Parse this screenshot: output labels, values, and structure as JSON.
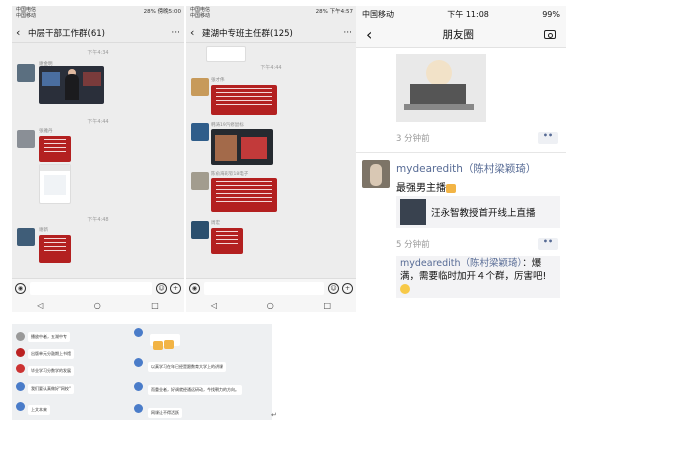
{
  "panel1": {
    "status": {
      "carrier1": "中国电信",
      "carrier2": "中国移动",
      "right": "28% 傍晚5:00"
    },
    "title": "中层干部工作群(61)",
    "more": "···",
    "times": [
      "下午4:34",
      "下午4:44",
      "下午4:48"
    ],
    "names": [
      "谢金明",
      "张雅丹",
      "谢新"
    ]
  },
  "panel2": {
    "status": {
      "carrier1": "中国电信",
      "carrier2": "中国移动",
      "right": "28% 下午4:57"
    },
    "title": "建湖中专班主任群(125)",
    "more": "···",
    "times": [
      "下午4:44"
    ],
    "names": [
      "张才伟",
      "韩涛19汽修鼠标",
      "陈俞海彩钦18电子",
      "周宏"
    ]
  },
  "moments": {
    "status": {
      "carrier": "中国移动",
      "time": "下午 11:08",
      "battery": "99%"
    },
    "title": "朋友圈",
    "time1": "3 分钟前",
    "author": "mydearedith（陈村梁颖琦）",
    "post_text": "最强男主播",
    "share_title": "汪永智教授首开线上直播",
    "time2": "5 分钟前",
    "comment_author": "mydearedith（陈村梁颖琦）",
    "comment_text": "：爆满，需要临时加开４个群，厉害吧!",
    "dots": "••"
  },
  "bottom_chat": {
    "lines": [
      "播放中者，五湖中专",
      "出版单元分鼓期上书馆",
      "毕业学习分数学的发展",
      "我们要认真做好\"网校\"",
      "上文本来",
      "以真学习在年已经是跟数育大学上的讲课",
      "而重业者，好调就经通远研动，今找朝力的方向。",
      "网课让不得活跃"
    ],
    "return_mark": "↵"
  },
  "colors": {
    "accent_link": "#576b95",
    "red_card": "#b32020"
  }
}
